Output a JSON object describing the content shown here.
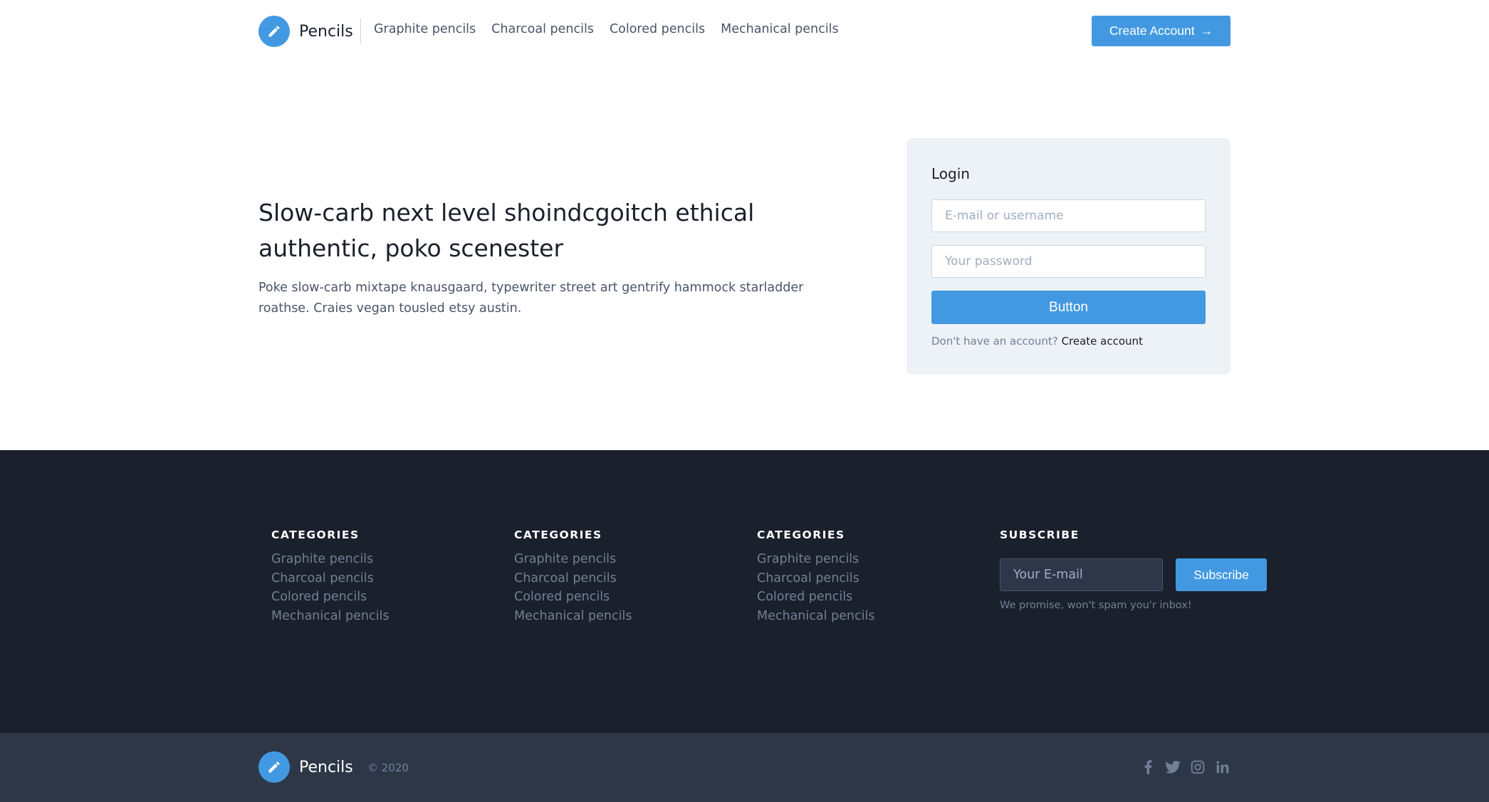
{
  "header": {
    "brand": "Pencils",
    "nav": [
      "Graphite pencils",
      "Charcoal pencils",
      "Colored pencils",
      "Mechanical pencils"
    ],
    "cta_label": "Create Account",
    "cta_arrow": "→"
  },
  "hero": {
    "title": "Slow-carb next level shoindcgoitch ethical authentic, poko scenester",
    "description": "Poke slow-carb mixtape knausgaard, typewriter street art gentrify hammock starladder roathse. Craies vegan tousled etsy austin."
  },
  "login": {
    "title": "Login",
    "username_placeholder": "E-mail or username",
    "password_placeholder": "Your password",
    "button_label": "Button",
    "footer_text": "Don't have an account?",
    "footer_link": "Create account"
  },
  "footer": {
    "columns": [
      {
        "heading": "CATEGORIES",
        "links": [
          "Graphite pencils",
          "Charcoal pencils",
          "Colored pencils",
          "Mechanical pencils"
        ]
      },
      {
        "heading": "CATEGORIES",
        "links": [
          "Graphite pencils",
          "Charcoal pencils",
          "Colored pencils",
          "Mechanical pencils"
        ]
      },
      {
        "heading": "CATEGORIES",
        "links": [
          "Graphite pencils",
          "Charcoal pencils",
          "Colored pencils",
          "Mechanical pencils"
        ]
      }
    ],
    "subscribe": {
      "heading": "SUBSCRIBE",
      "placeholder": "Your E-mail",
      "button_label": "Subscribe",
      "note": "We promise, won't spam you'r inbox!"
    }
  },
  "bottom": {
    "brand": "Pencils",
    "copyright": "© 2020",
    "socials": [
      "facebook-icon",
      "twitter-icon",
      "instagram-icon",
      "linkedin-icon"
    ]
  },
  "colors": {
    "accent": "#4299e1",
    "footer_dark": "#1a202c",
    "footer_bottom": "#2d3748",
    "card_bg": "#edf2f7"
  }
}
